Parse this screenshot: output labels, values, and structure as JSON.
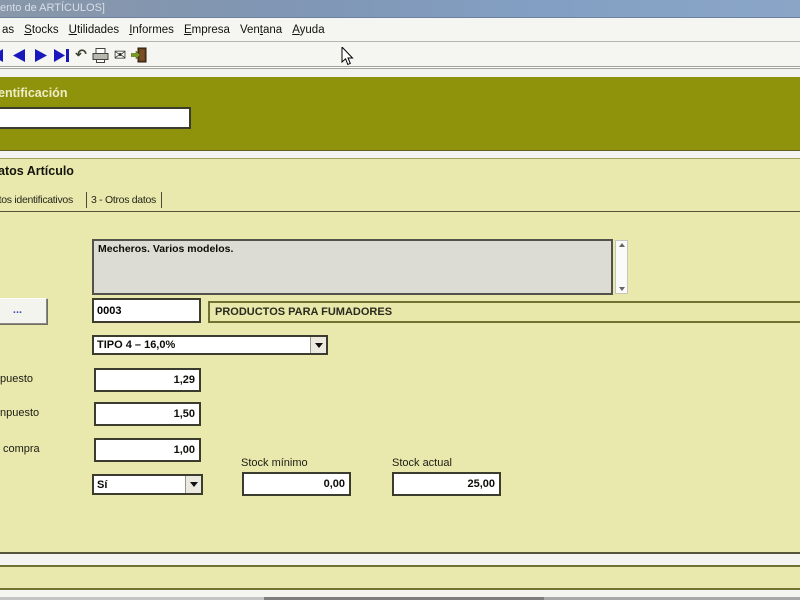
{
  "colors": {
    "olive_band": "#8f930b",
    "panel_yellow": "#e9e9ad",
    "title_blue": "#83a0c4",
    "nav_arrow_blue": "#1818bc",
    "field_border": "#3b3b2e"
  },
  "window": {
    "title": "ento de ARTÍCULOS]"
  },
  "menu": {
    "items": [
      {
        "pre": "as",
        "u": "",
        "post": ""
      },
      {
        "pre": "",
        "u": "S",
        "post": "tocks"
      },
      {
        "pre": "",
        "u": "U",
        "post": "tilidades"
      },
      {
        "pre": "",
        "u": "I",
        "post": "nformes"
      },
      {
        "pre": "",
        "u": "E",
        "post": "mpresa"
      },
      {
        "pre": "Ven",
        "u": "t",
        "post": "ana"
      },
      {
        "pre": "",
        "u": "A",
        "post": "yuda"
      }
    ]
  },
  "toolbar": {
    "icons": [
      "first-record",
      "previous-record",
      "next-record",
      "last-record",
      "undo",
      "print",
      "mail",
      "exit"
    ],
    "undo_glyph": "↶",
    "mail_glyph": "✉"
  },
  "identification": {
    "heading": "entificación",
    "search_value": ""
  },
  "article": {
    "heading": "atos Artículo",
    "tabs": [
      {
        "label": "s datos identificativos"
      },
      {
        "label": "3 - Otros datos"
      }
    ],
    "description": "Mecheros. Varios modelos.",
    "browse_button": "...",
    "family_code": "0003",
    "family_name": "PRODUCTOS PARA FUMADORES",
    "tax_type": "TIPO 4 – 16,0%",
    "price_rows": [
      {
        "label": "puesto",
        "value": "1,29"
      },
      {
        "label": "npuesto",
        "value": "1,50"
      },
      {
        "label": "compra",
        "value": "1,00"
      }
    ],
    "stock_control": "Sí",
    "stock_min": {
      "label": "Stock mínimo",
      "value": "0,00"
    },
    "stock_current": {
      "label": "Stock actual",
      "value": "25,00"
    }
  }
}
